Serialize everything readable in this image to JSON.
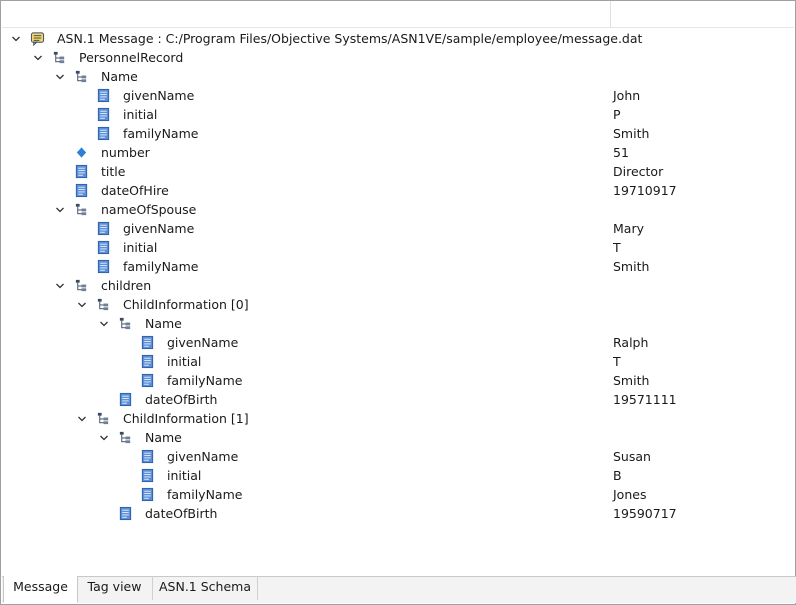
{
  "colors": {
    "accent": "#2f7fd6",
    "icon_blue": "#3b7fd0",
    "icon_dark": "#3a4a62",
    "text": "#1a1a1a"
  },
  "tree": [
    {
      "label": "ASN.1 Message : C:/Program Files/Objective Systems/ASN1VE/sample/employee/message.dat",
      "value": "",
      "depth": 0,
      "expanded": true,
      "icon": "message-icon"
    },
    {
      "label": "PersonnelRecord",
      "value": "",
      "depth": 1,
      "expanded": true,
      "icon": "structure-icon"
    },
    {
      "label": "Name",
      "value": "",
      "depth": 2,
      "expanded": true,
      "icon": "structure-icon"
    },
    {
      "label": "givenName",
      "value": "John",
      "depth": 3,
      "icon": "string-field-icon"
    },
    {
      "label": "initial",
      "value": "P",
      "depth": 3,
      "icon": "string-field-icon"
    },
    {
      "label": "familyName",
      "value": "Smith",
      "depth": 3,
      "icon": "string-field-icon"
    },
    {
      "label": "number",
      "value": "51",
      "depth": 2,
      "icon": "integer-diamond-icon"
    },
    {
      "label": "title",
      "value": "Director",
      "depth": 2,
      "icon": "string-field-icon"
    },
    {
      "label": "dateOfHire",
      "value": "19710917",
      "depth": 2,
      "icon": "string-field-icon"
    },
    {
      "label": "nameOfSpouse",
      "value": "",
      "depth": 2,
      "expanded": true,
      "icon": "structure-icon"
    },
    {
      "label": "givenName",
      "value": "Mary",
      "depth": 3,
      "icon": "string-field-icon"
    },
    {
      "label": "initial",
      "value": "T",
      "depth": 3,
      "icon": "string-field-icon"
    },
    {
      "label": "familyName",
      "value": "Smith",
      "depth": 3,
      "icon": "string-field-icon"
    },
    {
      "label": "children",
      "value": "",
      "depth": 2,
      "expanded": true,
      "icon": "structure-icon"
    },
    {
      "label": "ChildInformation [0]",
      "value": "",
      "depth": 3,
      "expanded": true,
      "icon": "structure-icon"
    },
    {
      "label": "Name",
      "value": "",
      "depth": 4,
      "expanded": true,
      "icon": "structure-icon"
    },
    {
      "label": "givenName",
      "value": "Ralph",
      "depth": 5,
      "icon": "string-field-icon"
    },
    {
      "label": "initial",
      "value": "T",
      "depth": 5,
      "icon": "string-field-icon"
    },
    {
      "label": "familyName",
      "value": "Smith",
      "depth": 5,
      "icon": "string-field-icon"
    },
    {
      "label": "dateOfBirth",
      "value": "19571111",
      "depth": 4,
      "icon": "string-field-icon"
    },
    {
      "label": "ChildInformation [1]",
      "value": "",
      "depth": 3,
      "expanded": true,
      "icon": "structure-icon"
    },
    {
      "label": "Name",
      "value": "",
      "depth": 4,
      "expanded": true,
      "icon": "structure-icon"
    },
    {
      "label": "givenName",
      "value": "Susan",
      "depth": 5,
      "icon": "string-field-icon"
    },
    {
      "label": "initial",
      "value": "B",
      "depth": 5,
      "icon": "string-field-icon"
    },
    {
      "label": "familyName",
      "value": "Jones",
      "depth": 5,
      "icon": "string-field-icon"
    },
    {
      "label": "dateOfBirth",
      "value": "19590717",
      "depth": 4,
      "icon": "string-field-icon"
    }
  ],
  "tabs": [
    {
      "label": "Message",
      "active": true
    },
    {
      "label": "Tag view",
      "active": false
    },
    {
      "label": "ASN.1 Schema",
      "active": false
    }
  ]
}
